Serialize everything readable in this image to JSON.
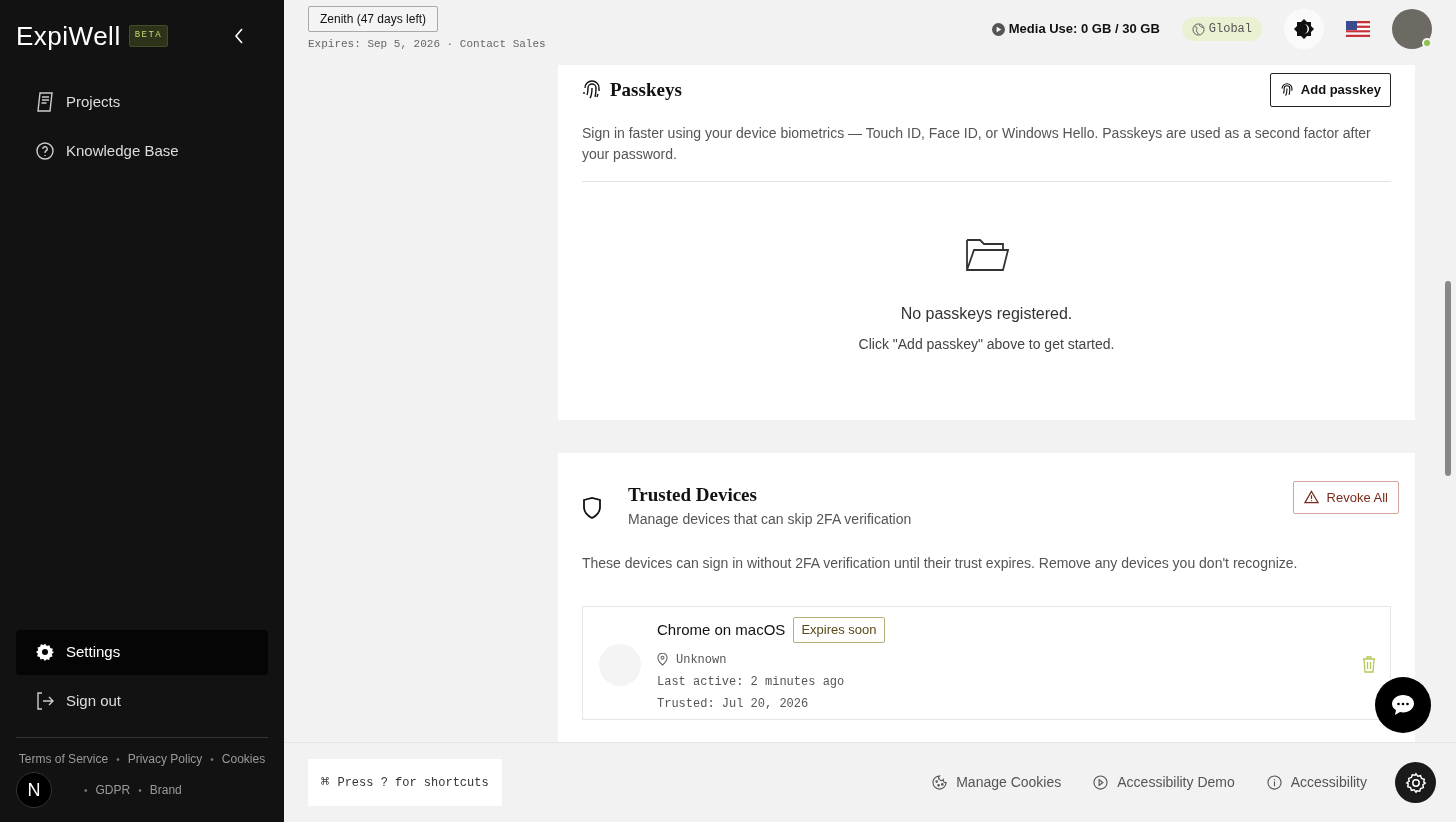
{
  "sidebar": {
    "logo": "ExpiWell",
    "logo_badge": "BETA",
    "nav": [
      {
        "label": "Projects",
        "selected": false
      },
      {
        "label": "Knowledge Base",
        "selected": false
      }
    ],
    "bottom_nav": [
      {
        "label": "Settings",
        "selected": true
      },
      {
        "label": "Sign out",
        "selected": false
      }
    ],
    "footer_links": [
      {
        "kind": "link",
        "label": "Terms of Service"
      },
      {
        "kind": "separator",
        "label": "•"
      },
      {
        "kind": "link",
        "label": "Privacy Policy"
      },
      {
        "kind": "separator",
        "label": "•"
      },
      {
        "kind": "link",
        "label": "Cookies"
      },
      {
        "kind": "separator",
        "label": "•"
      },
      {
        "kind": "link",
        "label": "GDPR"
      },
      {
        "kind": "separator",
        "label": "•"
      },
      {
        "kind": "link",
        "label": "Brand"
      }
    ],
    "user_badge": "N"
  },
  "topbar": {
    "plan": "Zenith (47 days left)",
    "expires": "Expires: Sep 5, 2026 · Contact Sales",
    "media_use": "Media Use: 0 GB / 30 GB",
    "region": "Global"
  },
  "passkeys": {
    "title": "Passkeys",
    "button": "Add passkey",
    "description": "Sign in faster using your device biometrics — Touch ID, Face ID, or Windows Hello. Passkeys are used as a second factor after your password.",
    "empty_title": "No passkeys registered.",
    "empty_hint": "Click \"Add passkey\" above to get started."
  },
  "trusted_devices": {
    "title": "Trusted Devices",
    "subtitle": "Manage devices that can skip 2FA verification",
    "button": "Revoke All",
    "description": "These devices can sign in without 2FA verification until their trust expires. Remove any devices you don't recognize.",
    "devices": [
      {
        "name": "Chrome on macOS",
        "badge": "Expires soon",
        "location": "Unknown",
        "last_active": "Last active: 2 minutes ago",
        "trusted": "Trusted: Jul 20, 2026"
      }
    ]
  },
  "bottom_bar": {
    "shortcut_symbol": "⌘",
    "shortcut_hint": "Press ? for shortcuts",
    "links": [
      "Manage Cookies",
      "Accessibility Demo",
      "Accessibility"
    ]
  }
}
